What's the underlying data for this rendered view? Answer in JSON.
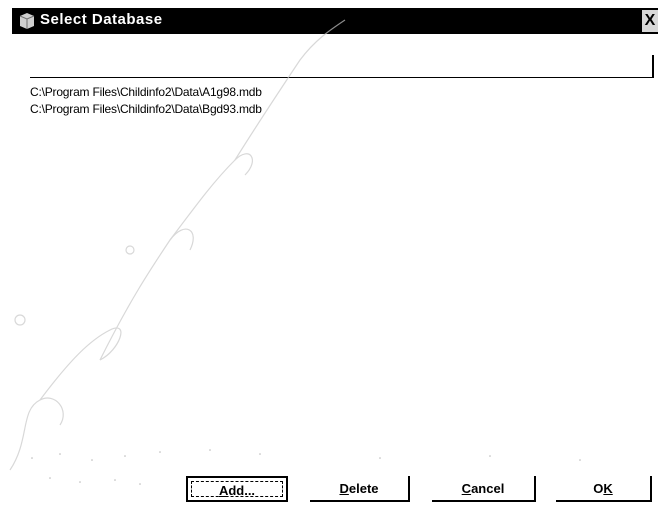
{
  "window": {
    "title": "Select Database",
    "close_glyph": "X",
    "icon": "database-app-icon"
  },
  "path_field": {
    "value": "",
    "placeholder": ""
  },
  "database_list": [
    "C:\\Program Files\\Childinfo2\\Data\\A1g98.mdb",
    "C:\\Program Files\\Childinfo2\\Data\\Bgd93.mdb"
  ],
  "buttons": {
    "add": {
      "accel": "A",
      "rest": "dd..."
    },
    "delete": {
      "accel": "D",
      "rest": "elete"
    },
    "cancel": {
      "accel": "C",
      "rest": "ancel"
    },
    "ok": {
      "pre": "O",
      "accel": "K"
    }
  },
  "colors": {
    "titlebar": "#000000",
    "title_text": "#ffffff",
    "background": "#ffffff",
    "watermark": "#c8c8c8"
  }
}
